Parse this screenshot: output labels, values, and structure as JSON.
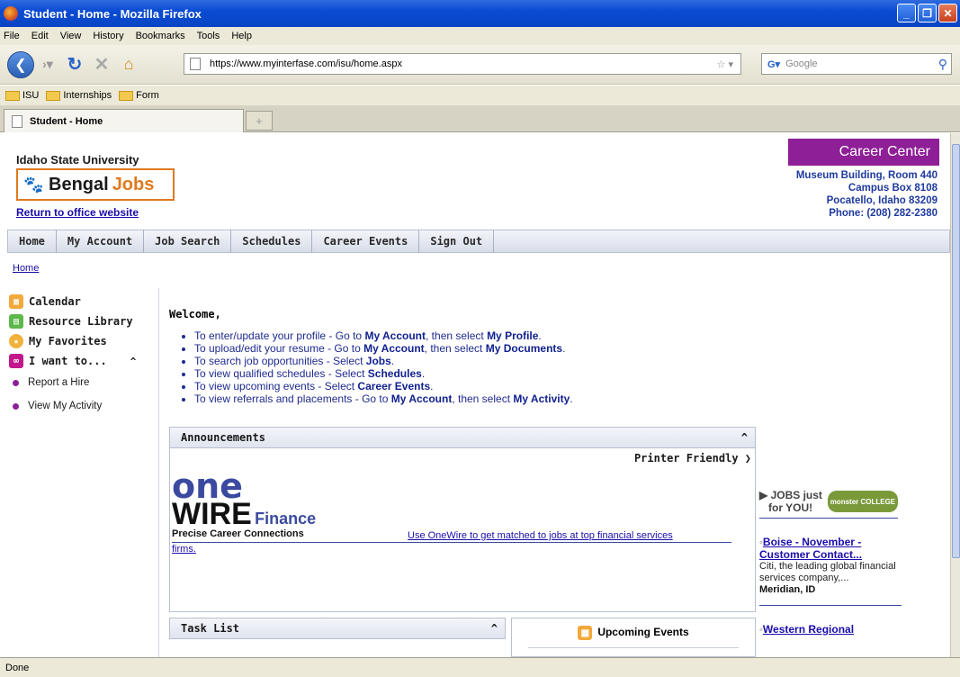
{
  "window": {
    "title": "Student - Home - Mozilla Firefox"
  },
  "menu": [
    "File",
    "Edit",
    "View",
    "History",
    "Bookmarks",
    "Tools",
    "Help"
  ],
  "url": "https://www.myinterfase.com/isu/home.aspx",
  "search_placeholder": "Google",
  "bookmarks": [
    "ISU",
    "Internships",
    "Form"
  ],
  "tab": {
    "title": "Student - Home"
  },
  "status": "Done",
  "logo": {
    "line1": "Idaho State University",
    "line2a": "Bengal",
    "line2b": "Jobs",
    "return": "Return to office website"
  },
  "career_center": {
    "title": "Career Center",
    "addr1": "Museum Building, Room 440",
    "addr2": "Campus Box 8108",
    "addr3": "Pocatello, Idaho 83209",
    "addr4": "Phone: (208) 282-2380"
  },
  "topnav": [
    "Home",
    "My Account",
    "Job Search",
    "Schedules",
    "Career Events",
    "Sign Out"
  ],
  "breadcrumb": "Home",
  "leftnav": {
    "calendar": "Calendar",
    "resource": "Resource Library",
    "favorites": "My Favorites",
    "iwant": "I want to...",
    "sub1": "Report a Hire",
    "sub2": "View My Activity"
  },
  "welcome": "Welcome,",
  "bullets": [
    {
      "pre": "To enter/update your profile - Go to ",
      "b1": "My Account",
      "mid": ", then select ",
      "b2": "My Profile",
      "post": "."
    },
    {
      "pre": "To upload/edit your resume - Go to ",
      "b1": "My Account",
      "mid": ", then select ",
      "b2": "My Documents",
      "post": "."
    },
    {
      "pre": "To search job opportunities - Select ",
      "b1": "Jobs",
      "mid": "",
      "b2": "",
      "post": "."
    },
    {
      "pre": "To view qualified schedules - Select ",
      "b1": "Schedules",
      "mid": "",
      "b2": "",
      "post": "."
    },
    {
      "pre": "To view upcoming events - Select ",
      "b1": "Career Events",
      "mid": "",
      "b2": "",
      "post": "."
    },
    {
      "pre": "To view referrals and placements - Go to ",
      "b1": "My Account",
      "mid": ", then select ",
      "b2": "My Activity",
      "post": "."
    }
  ],
  "announcements": {
    "title": "Announcements",
    "printer": "Printer Friendly",
    "one": "one",
    "wire": "WIRE",
    "finance": "Finance",
    "tagline": "Precise Career Connections",
    "link": "Use OneWire to get matched to jobs at top financial services",
    "link2": "firms."
  },
  "tasklist": {
    "title": "Task List"
  },
  "upcoming": {
    "title": "Upcoming Events"
  },
  "jobs": {
    "line1": "JOBS just",
    "line2": "for YOU!",
    "logo": "monster COLLEGE",
    "job1_title_a": "Boise - November -",
    "job1_title_b": "Customer Contact...",
    "job1_desc": "Citi, the leading global financial services company,...",
    "job1_loc": "Meridian, ID",
    "job2_title": "Western Regional"
  }
}
